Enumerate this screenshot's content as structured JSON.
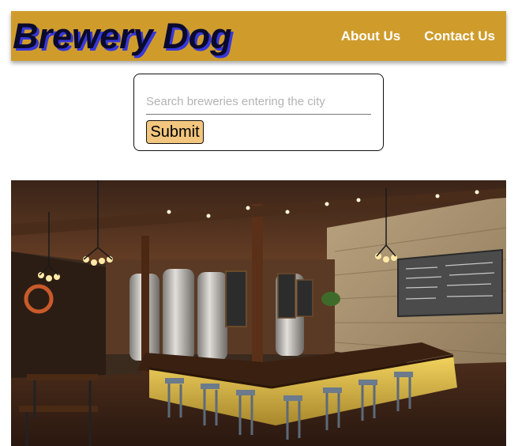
{
  "header": {
    "logo_text": "Brewery Dog",
    "nav": [
      {
        "label": "About Us"
      },
      {
        "label": "Contact Us"
      }
    ]
  },
  "search": {
    "placeholder": "Search breweries entering the city",
    "value": "",
    "submit_label": "Submit"
  },
  "colors": {
    "navbar": "#cf9c2c",
    "submit_button": "#f2c67e",
    "logo_text": "#0a0a2e",
    "logo_shadow": "#3838d8"
  },
  "hero": {
    "image": "brewery-interior-photo"
  }
}
